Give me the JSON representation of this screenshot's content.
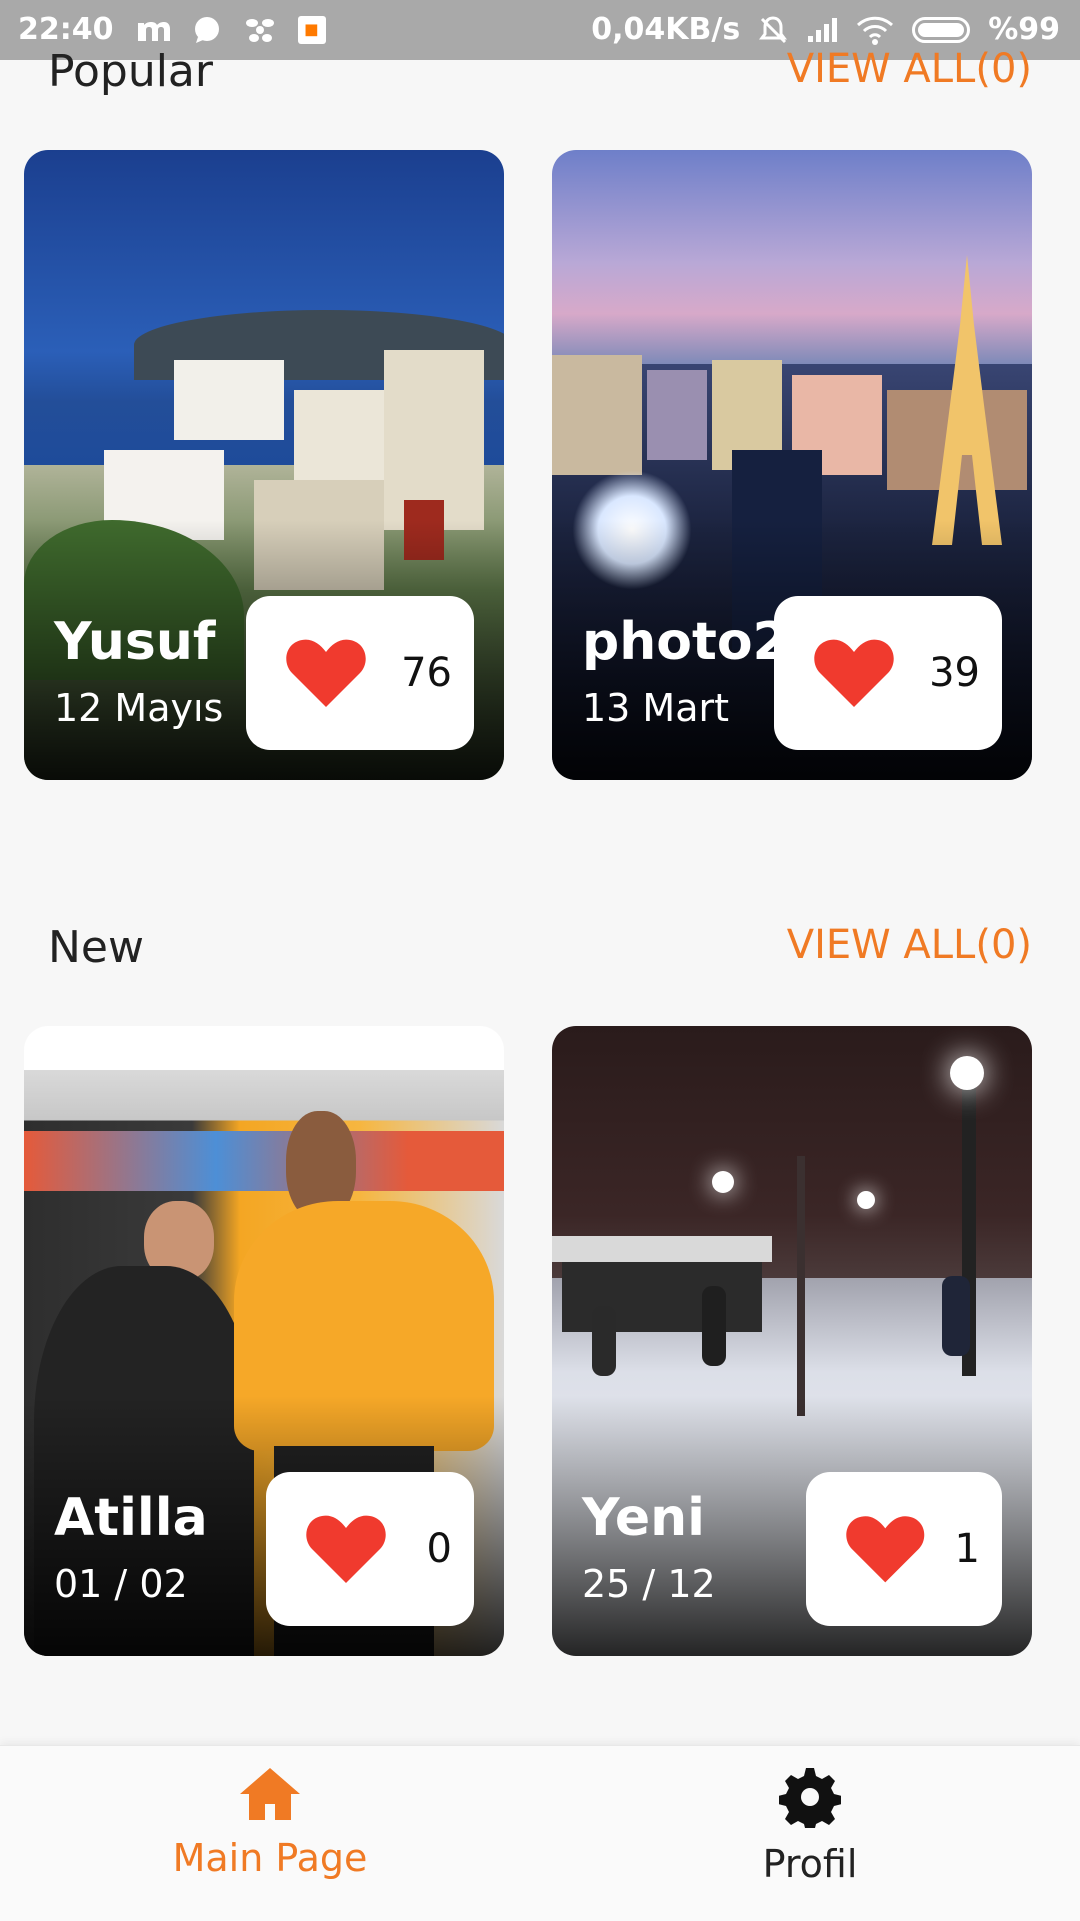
{
  "status_bar": {
    "time": "22:40",
    "network_speed": "0,04KB/s",
    "battery": "%99"
  },
  "sections": {
    "popular": {
      "title": "Popular",
      "view_all": "VIEW ALL(0)",
      "cards": [
        {
          "title": "Yusuf",
          "date": "12 Mayıs",
          "likes": "76"
        },
        {
          "title": "photo2",
          "date": "13 Mart",
          "likes": "39"
        }
      ]
    },
    "new": {
      "title": "New",
      "view_all": "VIEW ALL(0)",
      "cards": [
        {
          "title": "Atilla",
          "date": "01 / 02",
          "likes": "0"
        },
        {
          "title": "Yeni",
          "date": "25 / 12",
          "likes": "1"
        }
      ]
    }
  },
  "bottom_nav": {
    "items": [
      {
        "label": "Main Page",
        "icon": "home-icon",
        "active": true
      },
      {
        "label": "Profil",
        "icon": "gear-icon",
        "active": false
      }
    ]
  },
  "colors": {
    "accent": "#f07a24",
    "heart": "#f03a2e",
    "status_bar": "#a9a9a9"
  }
}
